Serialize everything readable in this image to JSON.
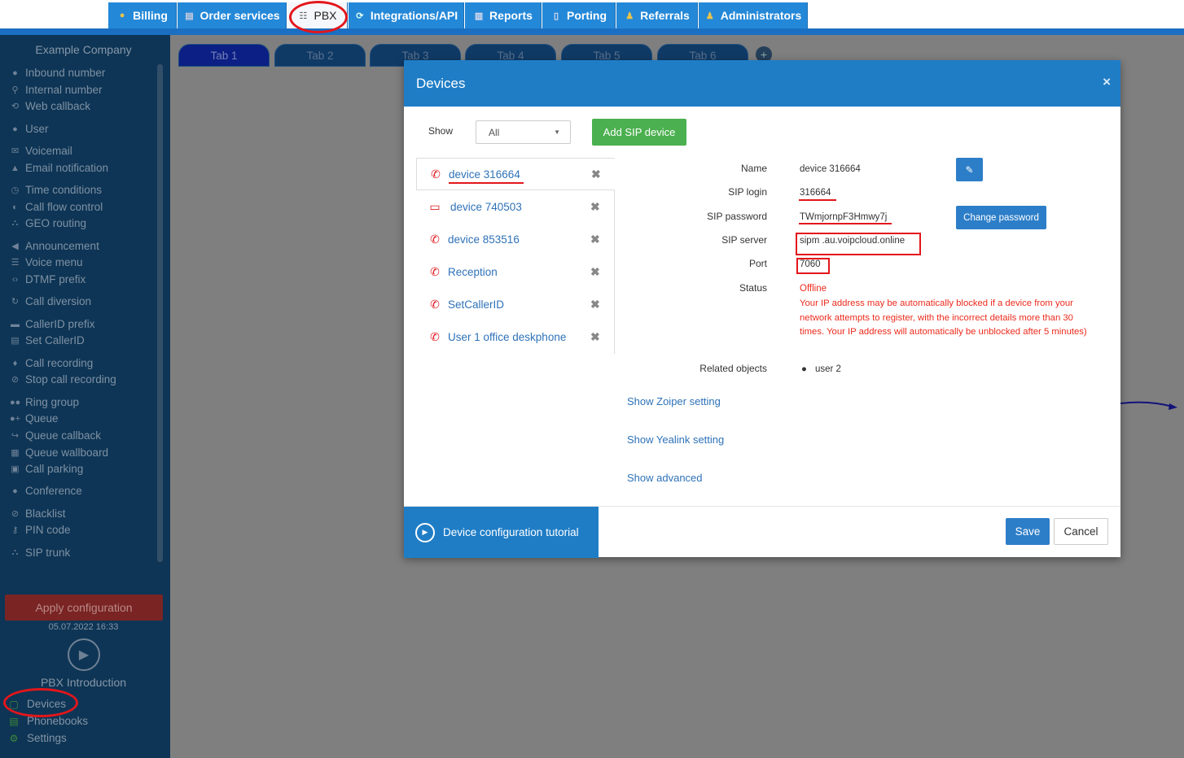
{
  "topnav": {
    "tabs": [
      {
        "label": "Billing",
        "icon": "coins-icon"
      },
      {
        "label": "Order services",
        "icon": "cart-icon"
      },
      {
        "label": "PBX",
        "icon": "pbx-icon",
        "active": true
      },
      {
        "label": "Integrations/API",
        "icon": "sync-icon"
      },
      {
        "label": "Reports",
        "icon": "report-icon"
      },
      {
        "label": "Porting",
        "icon": "porting-icon"
      },
      {
        "label": "Referrals",
        "icon": "referral-icon"
      },
      {
        "label": "Administrators",
        "icon": "admin-icon"
      }
    ]
  },
  "sidebar": {
    "company": "Example Company",
    "items": [
      {
        "label": "Inbound number",
        "icon": "globe-icon"
      },
      {
        "label": "Internal number",
        "icon": "pin-icon"
      },
      {
        "label": "Web callback",
        "icon": "callback-icon"
      },
      {
        "label": "User",
        "icon": "user-icon"
      },
      {
        "label": "Voicemail",
        "icon": "envelope-icon"
      },
      {
        "label": "Email notification",
        "icon": "bell-icon"
      },
      {
        "label": "Time conditions",
        "icon": "clock-icon"
      },
      {
        "label": "Call flow control",
        "icon": "toggle-icon"
      },
      {
        "label": "GEO routing",
        "icon": "sitemap-icon"
      },
      {
        "label": "Announcement",
        "icon": "megaphone-icon"
      },
      {
        "label": "Voice menu",
        "icon": "menu-icon"
      },
      {
        "label": "DTMF prefix",
        "icon": "code-icon"
      },
      {
        "label": "Call diversion",
        "icon": "redo-icon"
      },
      {
        "label": "CallerID prefix",
        "icon": "card-icon"
      },
      {
        "label": "Set CallerID",
        "icon": "id-card-icon"
      },
      {
        "label": "Call recording",
        "icon": "microphone-icon"
      },
      {
        "label": "Stop call recording",
        "icon": "mic-off-icon"
      },
      {
        "label": "Ring group",
        "icon": "group-icon"
      },
      {
        "label": "Queue",
        "icon": "user-plus-icon"
      },
      {
        "label": "Queue callback",
        "icon": "share-icon"
      },
      {
        "label": "Queue wallboard",
        "icon": "grid-icon"
      },
      {
        "label": "Call parking",
        "icon": "parking-icon"
      },
      {
        "label": "Conference",
        "icon": "conference-icon"
      },
      {
        "label": "Blacklist",
        "icon": "ban-icon"
      },
      {
        "label": "PIN code",
        "icon": "key-icon"
      },
      {
        "label": "SIP trunk",
        "icon": "trunk-icon"
      }
    ],
    "apply_label": "Apply configuration",
    "apply_date": "05.07.2022 16:33",
    "intro_label": "PBX Introduction",
    "bottom_items": [
      {
        "label": "Devices",
        "icon": "device-icon"
      },
      {
        "label": "Phonebooks",
        "icon": "book-icon"
      },
      {
        "label": "Settings",
        "icon": "gear-icon"
      }
    ]
  },
  "page_tabs": [
    "Tab 1",
    "Tab 2",
    "Tab 3",
    "Tab 4",
    "Tab 5",
    "Tab 6"
  ],
  "modal": {
    "title": "Devices",
    "close": "×",
    "show_label": "Show",
    "show_value": "All",
    "add_button": "Add SIP device",
    "devices": [
      {
        "label": "device 316664",
        "icon": "phone-icon",
        "selected": true
      },
      {
        "label": "device 740503",
        "icon": "monitor-icon"
      },
      {
        "label": "device 853516",
        "icon": "phone-icon"
      },
      {
        "label": "Reception",
        "icon": "phone-icon"
      },
      {
        "label": "SetCallerID",
        "icon": "phone-icon"
      },
      {
        "label": "User 1 office deskphone",
        "icon": "phone-icon"
      }
    ],
    "delete_glyph": "✖",
    "fields": {
      "name_label": "Name",
      "name_value": "device 316664",
      "login_label": "SIP login",
      "login_value": "316664",
      "password_label": "SIP password",
      "password_value": "TWmjornpF3Hmwy7j",
      "server_label": "SIP server",
      "server_value": "sipm .au.voipcloud.online",
      "port_label": "Port",
      "port_value": "7060",
      "status_label": "Status",
      "status_value": "Offline",
      "status_note": "Your IP address may be automatically blocked if a device from your network attempts to register, with the incorrect details more than 30 times. Your IP address will automatically be unblocked after 5 minutes)",
      "related_label": "Related objects",
      "related_value": "user 2"
    },
    "change_password": "Change password",
    "links": [
      "Show Zoiper setting",
      "Show Yealink setting",
      "Show advanced"
    ],
    "tutorial": "Device configuration tutorial",
    "save": "Save",
    "cancel": "Cancel"
  },
  "colors": {
    "nav_blue": "#2488d8",
    "sidebar_bg": "#0e3555",
    "modal_header": "#1f7dc6",
    "add_green": "#4bb04f",
    "annotation_red": "#e3161b",
    "status_red": "#ec2a1c"
  }
}
